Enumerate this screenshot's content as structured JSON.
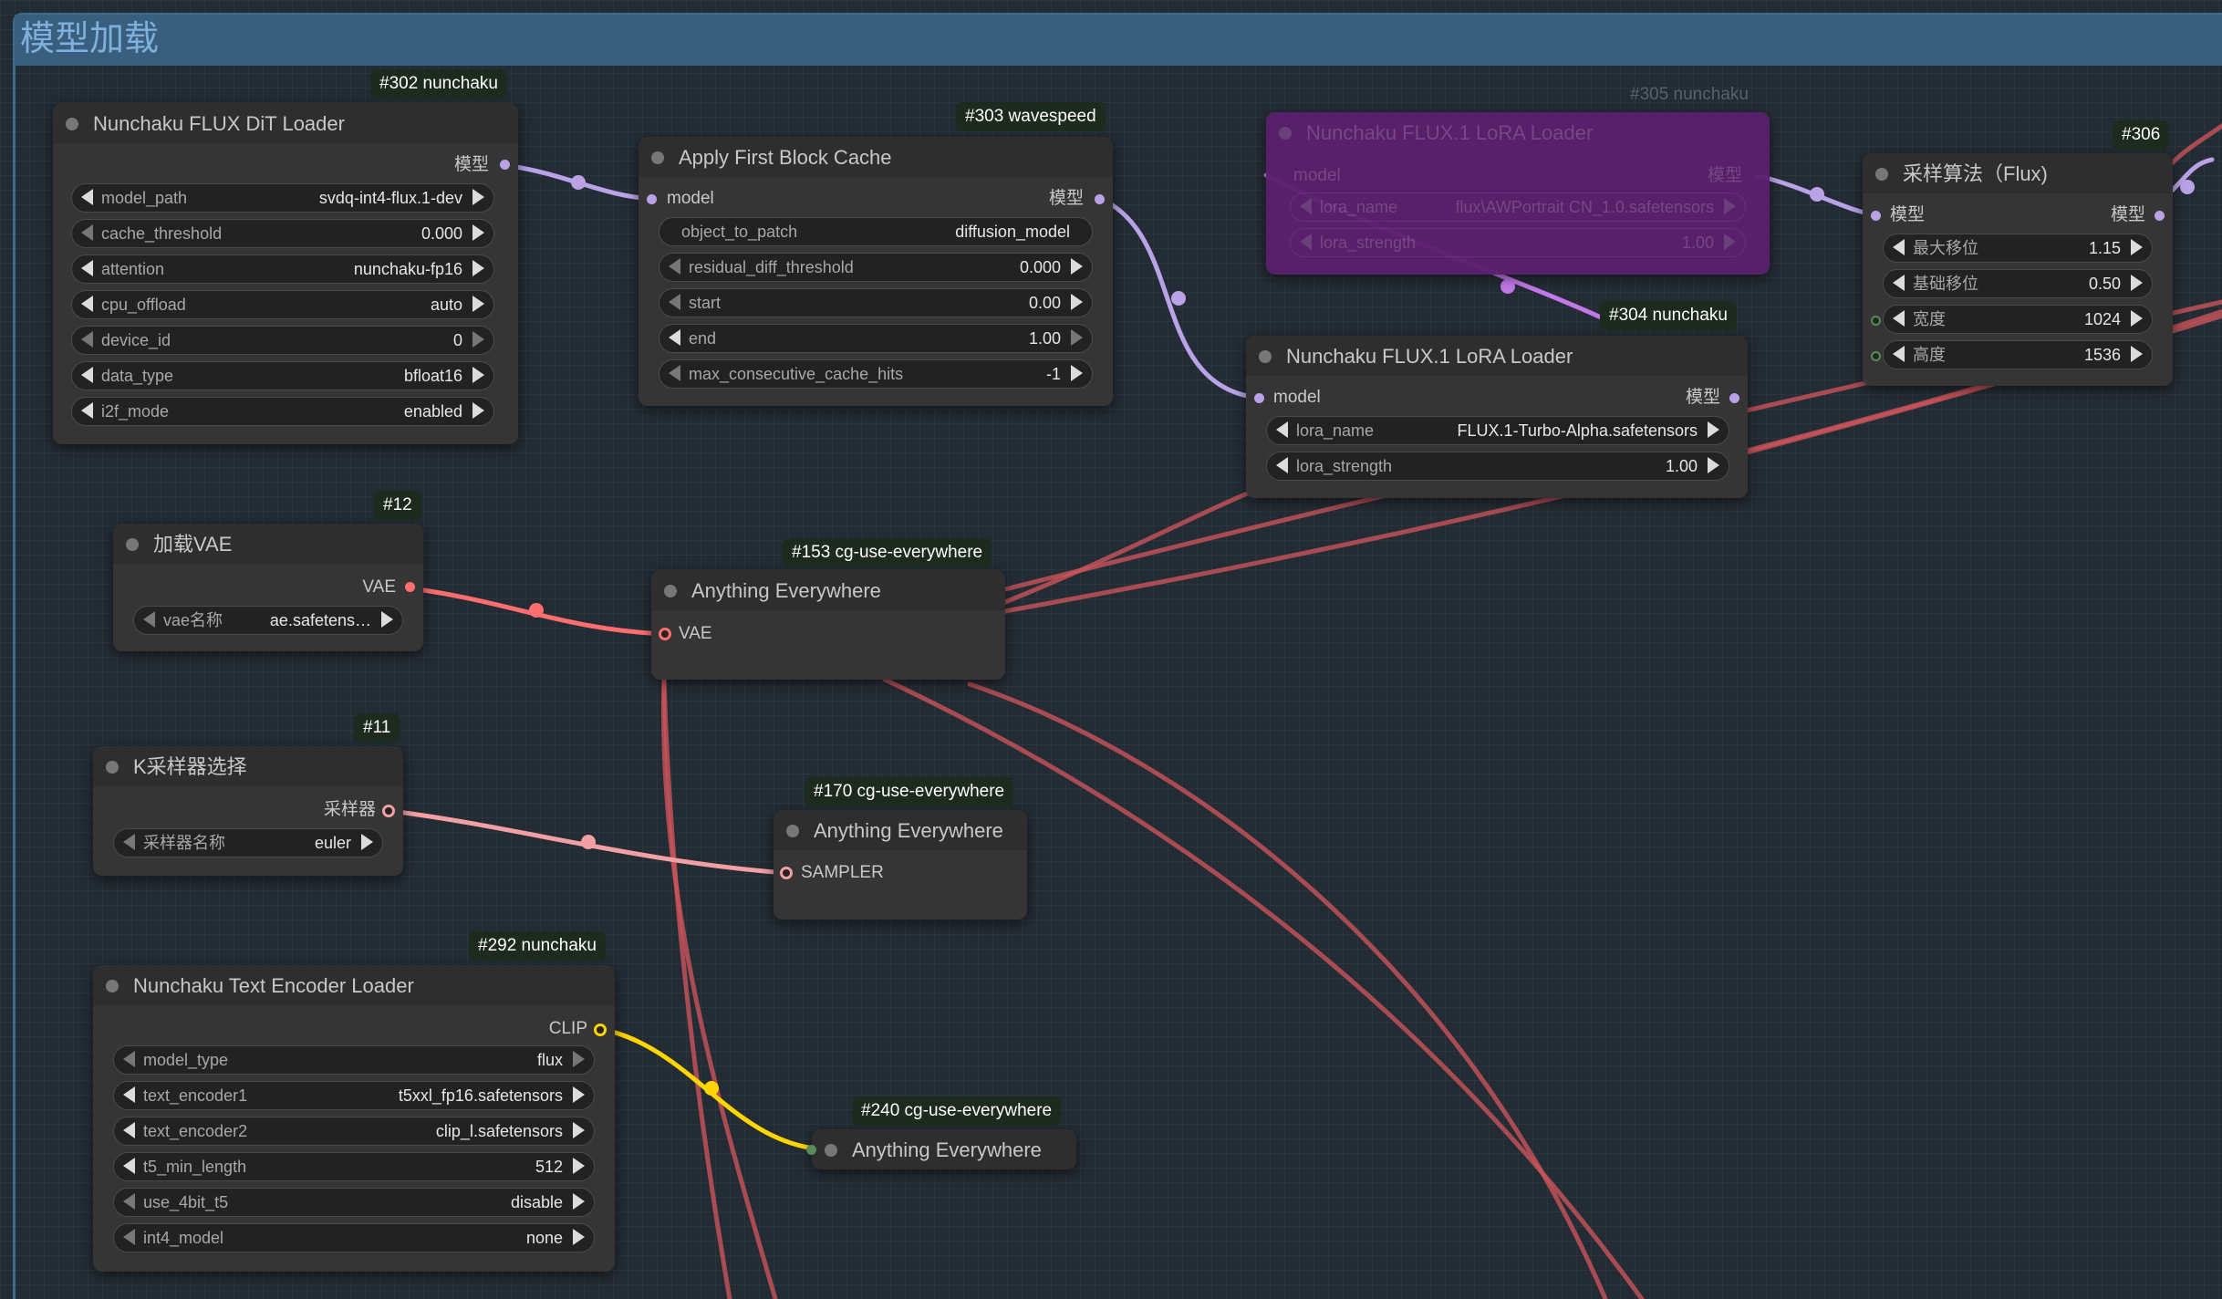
{
  "group": {
    "title": "模型加载"
  },
  "colors": {
    "model_link": "#b9a2e6",
    "vae_link": "#ff6e6e",
    "clip_link": "#ffd500",
    "sampler_link": "#f3a0a4",
    "bypass": "#5b1f6e",
    "group_border": "#3f6a8c"
  },
  "nodes": {
    "n302": {
      "badge": "#302 nunchaku",
      "title": "Nunchaku FLUX DiT Loader",
      "out_model": "模型",
      "widgets": [
        {
          "label": "model_path",
          "value": "svdq-int4-flux.1-dev"
        },
        {
          "label": "cache_threshold",
          "value": "0.000"
        },
        {
          "label": "attention",
          "value": "nunchaku-fp16"
        },
        {
          "label": "cpu_offload",
          "value": "auto"
        },
        {
          "label": "device_id",
          "value": "0"
        },
        {
          "label": "data_type",
          "value": "bfloat16"
        },
        {
          "label": "i2f_mode",
          "value": "enabled"
        }
      ]
    },
    "n303": {
      "badge": "#303 wavespeed",
      "title": "Apply First Block Cache",
      "in_model": "model",
      "out_model": "模型",
      "widgets": [
        {
          "label": "object_to_patch",
          "value": "diffusion_model"
        },
        {
          "label": "residual_diff_threshold",
          "value": "0.000"
        },
        {
          "label": "start",
          "value": "0.00"
        },
        {
          "label": "end",
          "value": "1.00"
        },
        {
          "label": "max_consecutive_cache_hits",
          "value": "-1"
        }
      ]
    },
    "n305": {
      "badge": "#305 nunchaku",
      "title": "Nunchaku FLUX.1 LoRA Loader",
      "in_model": "model",
      "out_model": "模型",
      "widgets": [
        {
          "label": "lora_name",
          "value": "flux\\AWPortrait CN_1.0.safetensors"
        },
        {
          "label": "lora_strength",
          "value": "1.00"
        }
      ]
    },
    "n304": {
      "badge": "#304 nunchaku",
      "title": "Nunchaku FLUX.1 LoRA Loader",
      "in_model": "model",
      "out_model": "模型",
      "widgets": [
        {
          "label": "lora_name",
          "value": "FLUX.1-Turbo-Alpha.safetensors"
        },
        {
          "label": "lora_strength",
          "value": "1.00"
        }
      ]
    },
    "n306": {
      "badge": "#306",
      "title": "采样算法（Flux)",
      "in_model": "模型",
      "out_model": "模型",
      "widgets": [
        {
          "label": "最大移位",
          "value": "1.15"
        },
        {
          "label": "基础移位",
          "value": "0.50"
        },
        {
          "label": "宽度",
          "value": "1024"
        },
        {
          "label": "高度",
          "value": "1536"
        }
      ]
    },
    "n12": {
      "badge": "#12",
      "title": "加载VAE",
      "out_vae": "VAE",
      "widgets": [
        {
          "label": "vae名称",
          "value": "ae.safetens…"
        }
      ]
    },
    "n153": {
      "badge": "#153 cg-use-everywhere",
      "title": "Anything Everywhere",
      "in": "VAE"
    },
    "n11": {
      "badge": "#11",
      "title": "K采样器选择",
      "out_sampler": "采样器",
      "widgets": [
        {
          "label": "采样器名称",
          "value": "euler"
        }
      ]
    },
    "n170": {
      "badge": "#170 cg-use-everywhere",
      "title": "Anything Everywhere",
      "in": "SAMPLER"
    },
    "n292": {
      "badge": "#292 nunchaku",
      "title": "Nunchaku Text Encoder Loader",
      "out_clip": "CLIP",
      "widgets": [
        {
          "label": "model_type",
          "value": "flux"
        },
        {
          "label": "text_encoder1",
          "value": "t5xxl_fp16.safetensors"
        },
        {
          "label": "text_encoder2",
          "value": "clip_l.safetensors"
        },
        {
          "label": "t5_min_length",
          "value": "512"
        },
        {
          "label": "use_4bit_t5",
          "value": "disable"
        },
        {
          "label": "int4_model",
          "value": "none"
        }
      ]
    },
    "n240": {
      "badge": "#240 cg-use-everywhere",
      "title": "Anything Everywhere"
    }
  }
}
